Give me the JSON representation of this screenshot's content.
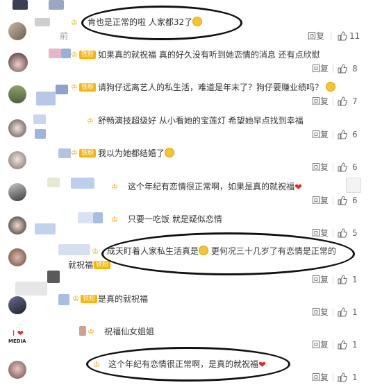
{
  "comments": [
    {
      "text": "肯也是正常的啦 人家都32了",
      "emoji": true,
      "heart": false,
      "likes": "11",
      "time_fragment": "前"
    },
    {
      "text": "如果真的就祝福 真的好久没有听到她恋情的消息 还有点欣慰",
      "emoji": false,
      "heart": false,
      "likes": "8",
      "badge": "铁粉"
    },
    {
      "text": "请狗仔远离艺人的私生活，难道是年末了？狗仔要赚业绩吗？",
      "emoji": true,
      "heart": false,
      "likes": "7",
      "badge": "铁粉"
    },
    {
      "text": "舒畅演技超级好 从小看她的宝莲灯 希望她早点找到幸福",
      "emoji": false,
      "heart": false,
      "likes": "6"
    },
    {
      "text": "我以为她都结婚了",
      "emoji": true,
      "heart": false,
      "likes": "6",
      "badge": "铁粉"
    },
    {
      "text": "这个年纪有恋情很正常啊，如果是真的就祝福",
      "emoji": false,
      "heart": true,
      "likes": "6"
    },
    {
      "text": "只要一吃饭 就是疑似恋情",
      "emoji": false,
      "heart": false,
      "likes": "5"
    },
    {
      "text": "成天盯着人家私生活真是",
      "text2": "更何况三十几岁了有恋情是正常的",
      "line2": "就祝福啊",
      "emoji": true,
      "heart": false,
      "likes": "1",
      "badge": "铁粉"
    },
    {
      "text": "是真的就祝福",
      "emoji": false,
      "heart": false,
      "likes": "1",
      "badge": "铁粉"
    },
    {
      "text": "祝福仙女姐姐",
      "emoji": false,
      "heart": false,
      "likes": "1"
    },
    {
      "text": "这个年纪有恋情很正常啊，是真的就祝福",
      "emoji": false,
      "heart": true,
      "likes": "1"
    }
  ],
  "labels": {
    "reply": "回复",
    "fan_badge": "铁粉",
    "media_label": "MEDIA"
  },
  "colors": {
    "annotation": "#111111",
    "badge_gold": "#f0a400",
    "heart": "#e0292b",
    "emoji": "#f6c431"
  }
}
